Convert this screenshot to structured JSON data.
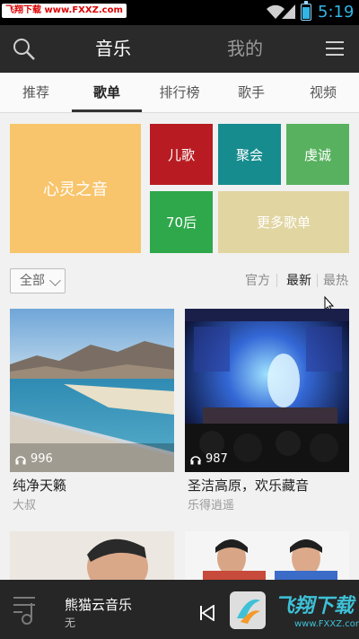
{
  "status_bar": {
    "watermark": "飞翔下载 www.FXXZ.com",
    "time": "5:19"
  },
  "app_bar": {
    "title_music": "音乐",
    "title_mine": "我的",
    "search_icon": "search-icon",
    "menu_icon": "hamburger-menu-icon"
  },
  "tabs": [
    {
      "label": "推荐"
    },
    {
      "label": "歌单",
      "active": true
    },
    {
      "label": "排行榜"
    },
    {
      "label": "歌手"
    },
    {
      "label": "视频"
    }
  ],
  "categories": {
    "featured": "心灵之音",
    "tiles": [
      {
        "label": "儿歌",
        "color": "#b81c22"
      },
      {
        "label": "聚会",
        "color": "#168c8e"
      },
      {
        "label": "虔诚",
        "color": "#58b15f"
      },
      {
        "label": "70后",
        "color": "#2ea84a"
      },
      {
        "label": "更多歌单",
        "color": "#e1d5a1"
      }
    ],
    "featured_color": "#f8c56c"
  },
  "filter": {
    "selected": "全部",
    "sort_options": [
      {
        "label": "官方"
      },
      {
        "label": "最新",
        "active": true
      },
      {
        "label": "最热"
      }
    ]
  },
  "playlists": [
    {
      "title": "纯净天籁",
      "subtitle": "大叔",
      "play_count": "996"
    },
    {
      "title": "圣洁高原，欢乐藏音",
      "subtitle": "乐得逍遥",
      "play_count": "987"
    }
  ],
  "player": {
    "title": "熊猫云音乐",
    "artist": "无",
    "logo_text": "飞翔下载",
    "logo_url": "www.FXXZ.com"
  }
}
